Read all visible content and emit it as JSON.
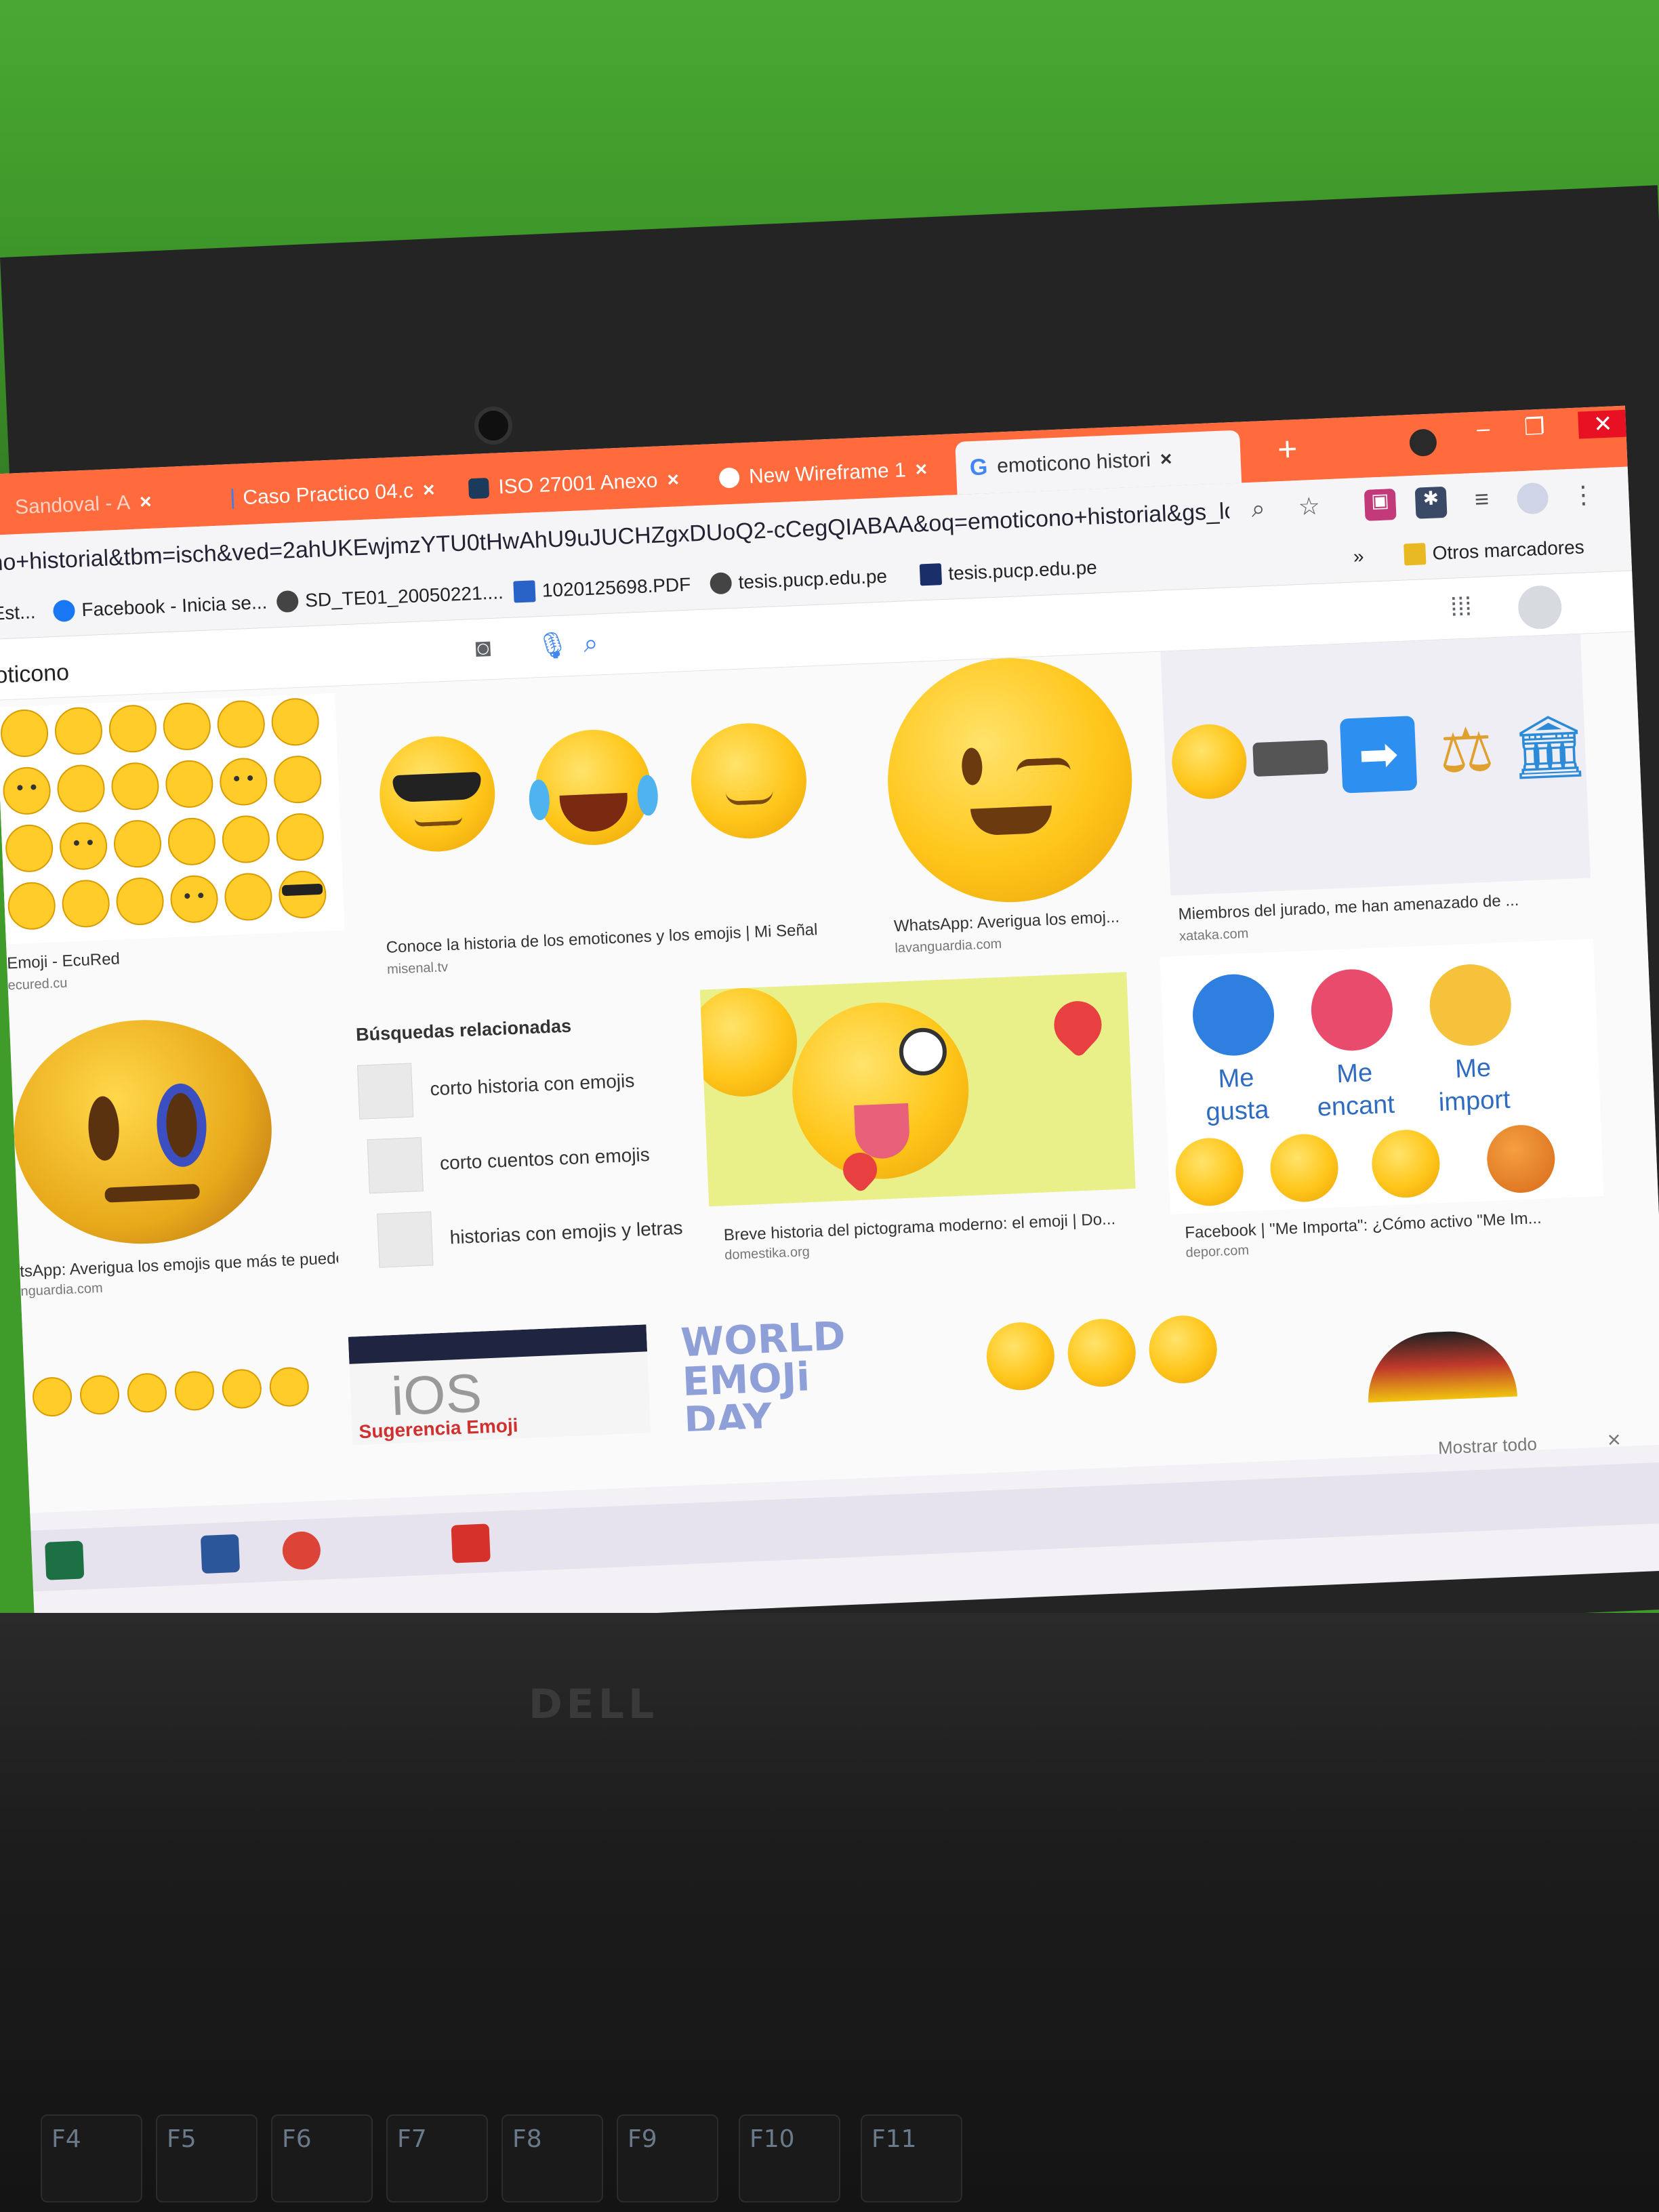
{
  "browser": {
    "tabs": [
      {
        "label": "Sandoval - A",
        "close": "×"
      },
      {
        "label": "Caso Practico 04.c",
        "close": "×"
      },
      {
        "label": "ISO 27001 Anexo",
        "close": "×"
      },
      {
        "label": "New Wireframe 1",
        "close": "×"
      },
      {
        "label": "emoticono histori",
        "close": "×"
      }
    ],
    "new_tab": "+",
    "window_controls": {
      "minimize": "–",
      "restore": "❐",
      "close": "✕"
    },
    "url": "no+historial&tbm=isch&ved=2ahUKEwjmzYTU0tHwAhU9uJUCHZgxDUoQ2-cCegQIABAA&oq=emoticono+historial&gs_lcp=...",
    "bookmarks": [
      {
        "label": "Est...",
        "icon": "page-icon"
      },
      {
        "label": "Facebook - Inicia se...",
        "icon": "facebook-icon"
      },
      {
        "label": "SD_TE01_20050221....",
        "icon": "globe-icon"
      },
      {
        "label": "1020125698.PDF",
        "icon": "document-icon"
      },
      {
        "label": "tesis.pucp.edu.pe",
        "icon": "globe-icon"
      },
      {
        "label": "tesis.pucp.edu.pe",
        "icon": "d-icon"
      }
    ],
    "bookmarks_overflow": "»",
    "other_bookmarks": "Otros marcadores"
  },
  "search": {
    "query": "oticono"
  },
  "results": [
    {
      "caption": "Emoji - EcuRed",
      "source": "ecured.cu"
    },
    {
      "caption": "Conoce la historia de los emoticones y los emojis | Mi Señal",
      "source": "misenal.tv"
    },
    {
      "caption": "WhatsApp: Averigua los emoj...",
      "source": "lavanguardia.com"
    },
    {
      "caption": "Miembros del jurado, me han amenazado de ...",
      "source": "xataka.com"
    },
    {
      "caption": "tsApp: Averigua los emojis que más te pueden ...",
      "source": "nguardia.com"
    },
    {
      "caption": "Breve historia del pictograma moderno: el emoji | Do...",
      "source": "domestika.org"
    },
    {
      "caption": "Facebook | \"Me Importa\": ¿Cómo activo \"Me Im...",
      "source": "depor.com"
    }
  ],
  "related": {
    "title": "Búsquedas relacionadas",
    "items": [
      "corto historia con emojis",
      "corto cuentos con emojis",
      "historias con emojis y letras"
    ]
  },
  "reactions": [
    {
      "label": "Me\ngusta",
      "color": "#2f7fe0"
    },
    {
      "label": "Me\nencant",
      "color": "#e94b6c"
    },
    {
      "label": "Me\nimport",
      "color": "#f6c23b"
    }
  ],
  "bottom_tiles": {
    "ios_text": "iOS",
    "ios_caption": "Sugerencia Emoji",
    "world_emoji": "WORLD\nEMOJi\nDAY"
  },
  "download_bar": {
    "show_all": "Mostrar todo",
    "close": "×"
  },
  "laptop": {
    "brand": "DELL",
    "keys": [
      {
        "label": "F4",
        "sub": "⏮"
      },
      {
        "label": "F5",
        "sub": "⏯"
      },
      {
        "label": "F6",
        "sub": "⏭"
      },
      {
        "label": "F7"
      },
      {
        "label": "F8"
      },
      {
        "label": "F9"
      },
      {
        "label": "F10"
      },
      {
        "label": "F11"
      }
    ]
  },
  "colors": {
    "tabstrip": "#ff6b3d",
    "wall": "#3f9b2a",
    "emoji_yellow": "#ffc61a"
  }
}
